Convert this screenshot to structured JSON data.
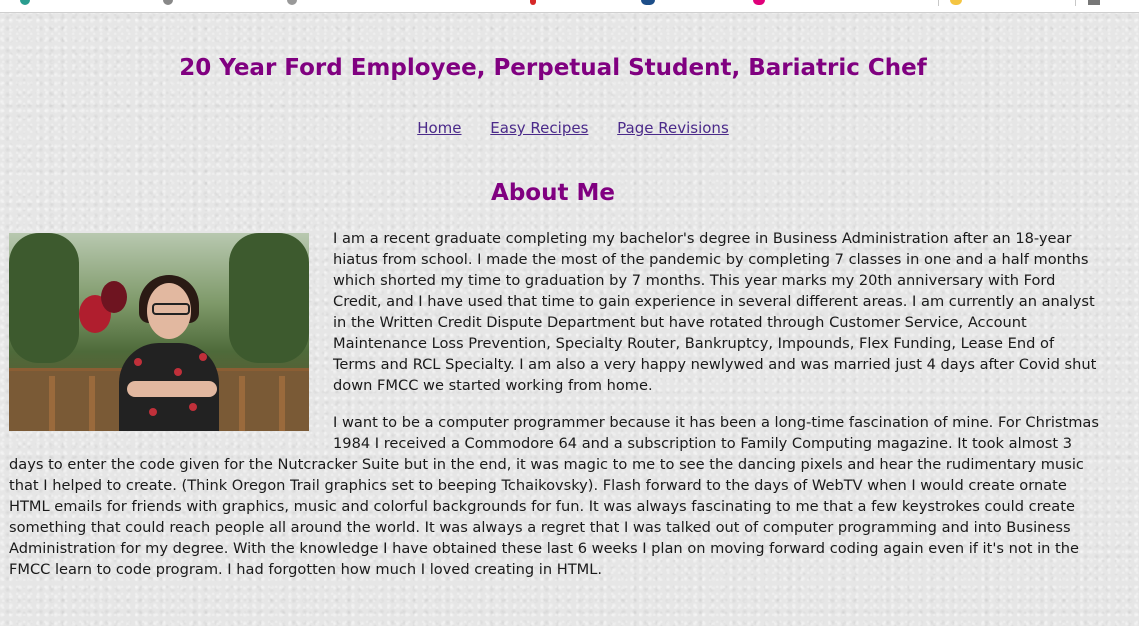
{
  "header": {
    "title": "20 Year Ford Employee, Perpetual Student, Bariatric Chef"
  },
  "nav": {
    "items": [
      "Home",
      "Easy Recipes",
      "Page Revisions"
    ]
  },
  "about": {
    "heading": "About Me",
    "paragraphs": [
      "I am a recent graduate completing my bachelor's degree in Business Administration after an 18-year hiatus from school. I made the most of the pandemic by completing 7 classes in one and a half months which shorted my time to graduation by 7 months. This year marks my 20th anniversary with Ford Credit, and I have used that time to gain experience in several different areas. I am currently an analyst in the Written Credit Dispute Department but have rotated through Customer Service, Account Maintenance Loss Prevention, Specialty Router, Bankruptcy, Impounds, Flex Funding, Lease End of Terms and RCL Specialty. I am also a very happy newlywed and was married just 4 days after Covid shut down FMCC we started working from home.",
      "I want to be a computer programmer because it has been a long-time fascination of mine. For Christmas 1984 I received a Commodore 64 and a subscription to Family Computing magazine. It took almost 3 days to enter the code given for the Nutcracker Suite but in the end, it was magic to me to see the dancing pixels and hear the rudimentary music that I helped to create. (Think Oregon Trail graphics set to beeping Tchaikovsky). Flash forward to the days of WebTV when I would create ornate HTML emails for friends with graphics, music and colorful backgrounds for fun. It was always fascinating to me that a few keystrokes could create something that could reach people all around the world. It was always a regret that I was talked out of computer programming and into Business Administration for my degree. With the knowledge I have obtained these last 6 weeks I plan on moving forward coding again even if it's not in the FMCC learn to code program. I had forgotten how much I loved creating in HTML."
    ]
  },
  "colors": {
    "heading": "#800080",
    "link": "#4b2a8a",
    "text": "#1a1a1a",
    "background": "#e6e6e6"
  }
}
